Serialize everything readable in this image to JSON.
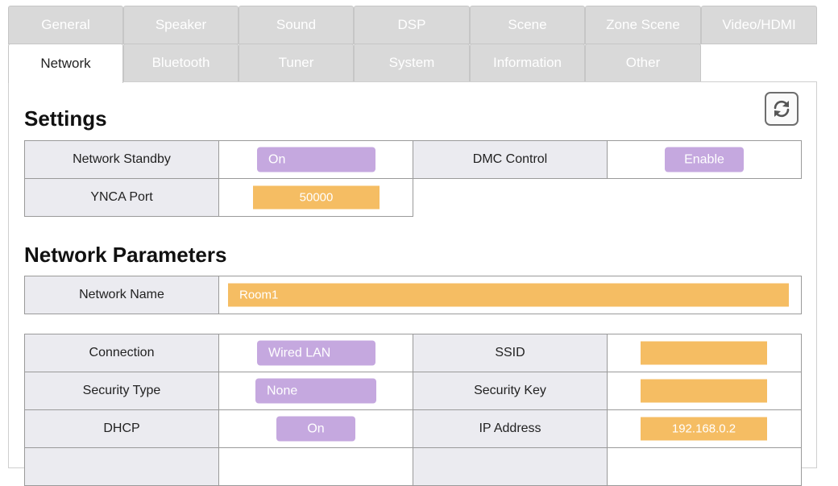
{
  "tabs": {
    "row1": [
      "General",
      "Speaker",
      "Sound",
      "DSP",
      "Scene",
      "Zone Scene",
      "Video/HDMI"
    ],
    "row2": [
      "Network",
      "Bluetooth",
      "Tuner",
      "System",
      "Information",
      "Other"
    ],
    "active": "Network"
  },
  "settings": {
    "heading": "Settings",
    "network_standby": {
      "label": "Network Standby",
      "value": "On"
    },
    "dmc_control": {
      "label": "DMC Control",
      "value": "Enable"
    },
    "ynca_port": {
      "label": "YNCA Port",
      "value": "50000"
    }
  },
  "network_parameters": {
    "heading": "Network Parameters",
    "network_name": {
      "label": "Network Name",
      "value": "Room1"
    },
    "connection": {
      "label": "Connection",
      "value": "Wired LAN"
    },
    "ssid": {
      "label": "SSID",
      "value": ""
    },
    "security_type": {
      "label": "Security Type",
      "value": "None"
    },
    "security_key": {
      "label": "Security Key",
      "value": ""
    },
    "dhcp": {
      "label": "DHCP",
      "value": "On"
    },
    "ip_address": {
      "label": "IP Address",
      "value": "192.168.0.2"
    }
  },
  "icons": {
    "refresh": "refresh-icon"
  },
  "colors": {
    "pill": "#c5a8df",
    "field": "#f5bd63",
    "label_cell": "#ebebf0",
    "tab": "#d9d9d9"
  }
}
